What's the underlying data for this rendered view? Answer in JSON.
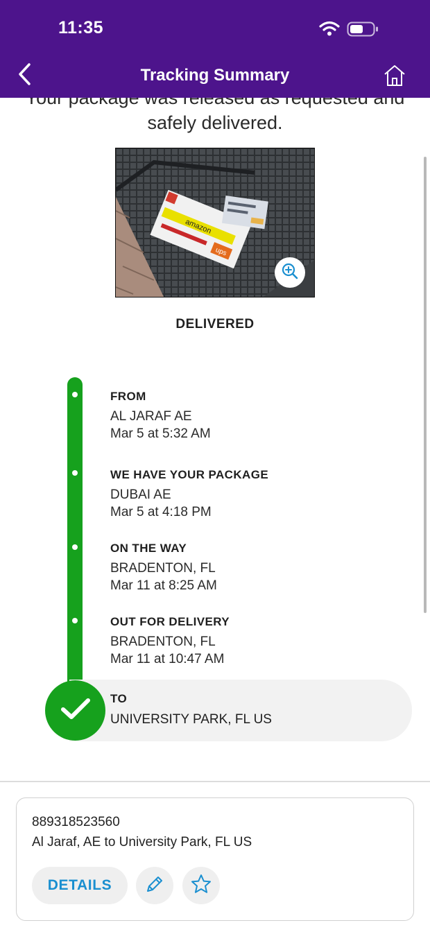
{
  "status_bar": {
    "time": "11:35"
  },
  "nav": {
    "title": "Tracking Summary"
  },
  "message": {
    "line1": "Your package was released as requested and",
    "line2": "safely delivered."
  },
  "photo": {
    "box_text_1": "amazon",
    "box_text_2": "ups"
  },
  "status": {
    "label": "DELIVERED"
  },
  "timeline": {
    "steps": [
      {
        "title": "FROM",
        "location": "AL JARAF AE",
        "time": "Mar 5 at 5:32 AM"
      },
      {
        "title": "WE HAVE YOUR PACKAGE",
        "location": "DUBAI AE",
        "time": "Mar 5 at 4:18 PM"
      },
      {
        "title": "ON THE WAY",
        "location": "BRADENTON, FL",
        "time": "Mar 11 at 8:25 AM"
      },
      {
        "title": "OUT FOR DELIVERY",
        "location": "BRADENTON, FL",
        "time": "Mar 11 at 10:47 AM"
      }
    ],
    "destination": {
      "title": "TO",
      "location": "UNIVERSITY PARK, FL  US"
    }
  },
  "card": {
    "tracking_number": "889318523560",
    "route": "Al Jaraf, AE to University Park, FL US",
    "details_label": "DETAILS"
  },
  "colors": {
    "header": "#4d148c",
    "progress": "#16a11d",
    "link": "#1a8fd0"
  },
  "icons": [
    "back-chevron-icon",
    "home-icon",
    "wifi-icon",
    "battery-icon",
    "zoom-in-icon",
    "checkmark-icon",
    "pencil-icon",
    "star-icon"
  ]
}
